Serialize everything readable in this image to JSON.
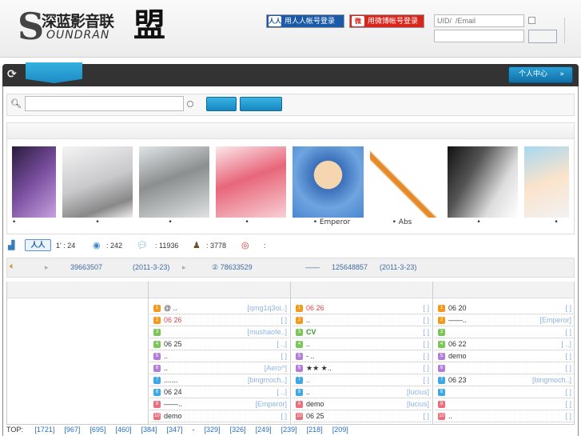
{
  "logo": {
    "cn": "深蓝影音联",
    "meng": "盟",
    "en": "OUNDRAN",
    "s": "S"
  },
  "login": {
    "renren": "用人人帐号登录",
    "weibo": "用微博帐号登录",
    "uid_placeholder": "UID/  /Email",
    "renren_icon": "人人",
    "weibo_icon": "微"
  },
  "nav": {
    "user_center": "个人中心",
    "chevron": "»"
  },
  "gallery": [
    {
      "caption": "•"
    },
    {
      "caption": "•"
    },
    {
      "caption": "•"
    },
    {
      "caption": "•"
    },
    {
      "caption": "• Emperor"
    },
    {
      "caption": "• Abs"
    },
    {
      "caption": "•"
    },
    {
      "caption": "•"
    }
  ],
  "stats": {
    "renren": "人人",
    "s1": "1' : 24",
    "s2": ": 242",
    "s3": ": 11936",
    "s4": ": 3778",
    "s5": ":"
  },
  "notice": {
    "a1": "39663507",
    "d1": "(2011-3-23)",
    "a2": "② 78633529",
    "dash": "——",
    "a3": "125648857",
    "d2": "(2011-3-23)"
  },
  "columns": [
    {
      "rows": [
        {
          "t": "@ ..",
          "a": "[qmg1q3oi..]"
        },
        {
          "t": "06 26",
          "a": "[ ]",
          "hot": true
        },
        {
          "t": "",
          "a": "[mushaofe..]"
        },
        {
          "t": "06 25",
          "a": "[ ..]"
        },
        {
          "t": "..",
          "a": "[ ]"
        },
        {
          "t": "..",
          "a": "[Aero^]"
        },
        {
          "t": ".......",
          "a": "[bingmoch..]"
        },
        {
          "t": "06 24",
          "a": "[ ..]"
        },
        {
          "t": "——..",
          "a": "[Emperor]"
        },
        {
          "t": "demo",
          "a": "[ ]"
        }
      ]
    },
    {
      "rows": [
        {
          "t": "06 26",
          "a": "[ ]",
          "hot": true
        },
        {
          "t": "..",
          "a": "[ ]"
        },
        {
          "t": "CV",
          "a": "[ ]",
          "green": true
        },
        {
          "t": "..",
          "a": "[ ]"
        },
        {
          "t": "-    ..",
          "a": "[ ]"
        },
        {
          "t": "★★    ★..",
          "a": "[ ]"
        },
        {
          "t": "..",
          "a": "[ ]",
          "hot": true
        },
        {
          "t": "..",
          "a": "[lucius]"
        },
        {
          "t": "demo",
          "a": "[lucius]"
        },
        {
          "t": "06 25",
          "a": "[ ]"
        }
      ]
    },
    {
      "rows": [
        {
          "t": "06 20",
          "a": "[ ]"
        },
        {
          "t": "——..",
          "a": "[Emperor]"
        },
        {
          "t": "",
          "a": "[ ]"
        },
        {
          "t": "06 22",
          "a": "[ ..]"
        },
        {
          "t": "demo",
          "a": "[ ]"
        },
        {
          "t": "",
          "a": "[ ]"
        },
        {
          "t": "06 23",
          "a": "[bingmoch..]"
        },
        {
          "t": "",
          "a": "[ ]"
        },
        {
          "t": "",
          "a": "[ ]"
        },
        {
          "t": "..",
          "a": "[ ]"
        }
      ]
    }
  ],
  "ranks": [
    "1",
    "2",
    "3",
    "4",
    "5",
    "6",
    "7",
    "8",
    "9",
    "10"
  ],
  "rank_colors": [
    "#f39a1c",
    "#f39a1c",
    "#7bc55a",
    "#7bc55a",
    "#b37ed8",
    "#b37ed8",
    "#3ea7e6",
    "#3ea7e6",
    "#ea6f7d",
    "#ea6f7d"
  ],
  "footer": {
    "label": "TOP:",
    "links": [
      "[1721]",
      "[967]",
      "[695]",
      "[460]",
      "[384]",
      "[347]",
      "-",
      "[329]",
      "[326]",
      "[249]",
      "[239]",
      "[218]",
      "[209]"
    ]
  }
}
